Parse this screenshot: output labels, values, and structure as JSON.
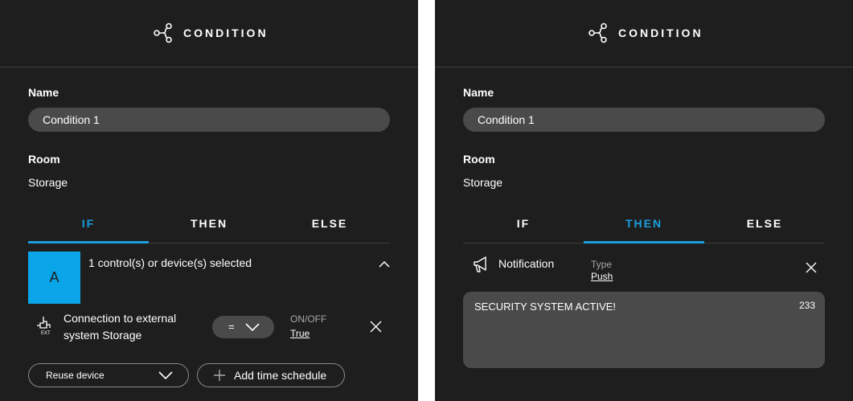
{
  "left_panel": {
    "header": {
      "title": "CONDITION",
      "icon": "share-nodes-icon"
    },
    "name_label": "Name",
    "name_value": "Condition 1",
    "room_label": "Room",
    "room_value": "Storage",
    "tabs": [
      {
        "label": "IF",
        "active": true
      },
      {
        "label": "THEN",
        "active": false
      },
      {
        "label": "ELSE",
        "active": false
      }
    ],
    "if_section": {
      "avatar_letter": "A",
      "selection_text": "1 control(s) or device(s) selected",
      "condition_row": {
        "icon": "external-connection-icon",
        "icon_text": "EXT",
        "device_name": "Connection to external system Storage",
        "operator": "=",
        "value_label": "ON/OFF",
        "value": "True"
      },
      "reuse_button": "Reuse device",
      "schedule_button": "Add time schedule"
    }
  },
  "right_panel": {
    "header": {
      "title": "CONDITION",
      "icon": "share-nodes-icon"
    },
    "name_label": "Name",
    "name_value": "Condition 1",
    "room_label": "Room",
    "room_value": "Storage",
    "tabs": [
      {
        "label": "IF",
        "active": false
      },
      {
        "label": "THEN",
        "active": true
      },
      {
        "label": "ELSE",
        "active": false
      }
    ],
    "then_section": {
      "action_icon": "megaphone-icon",
      "action_label": "Notification",
      "type_label": "Type",
      "type_value": "Push",
      "message": "SECURITY SYSTEM ACTIVE!",
      "char_count": "233"
    }
  },
  "colors": {
    "background": "#1e1e1e",
    "input": "#4a4a4a",
    "accent": "#1a9fe0",
    "avatar": "#0aa5e8",
    "muted_text": "#a8a8a8"
  }
}
